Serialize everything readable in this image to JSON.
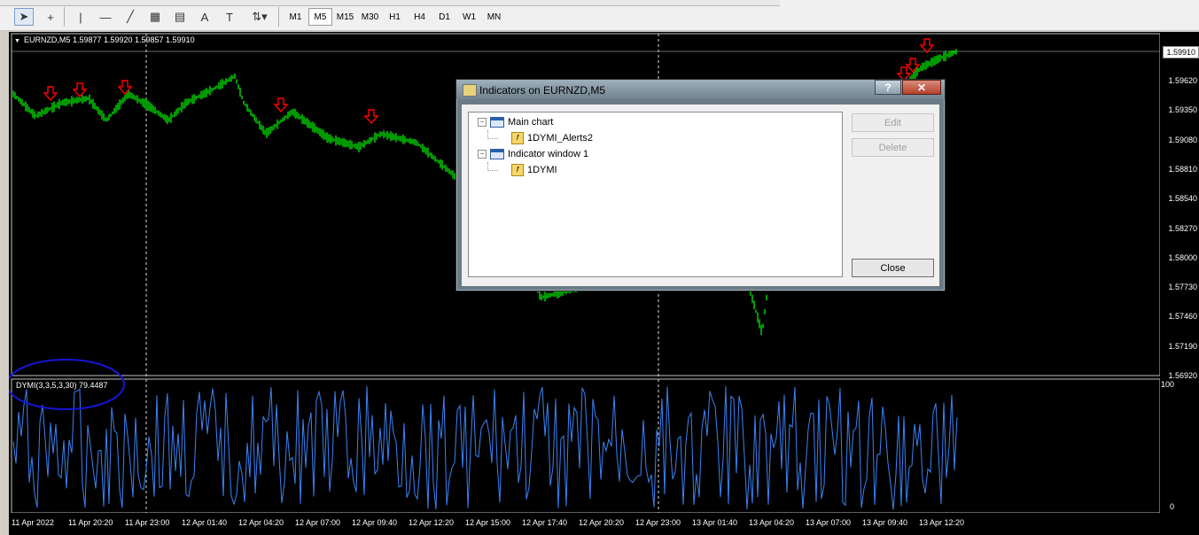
{
  "toolbar": {
    "timeframes": [
      "M1",
      "M5",
      "M15",
      "M30",
      "H1",
      "H4",
      "D1",
      "W1",
      "MN"
    ],
    "active_timeframe": "M5"
  },
  "chart": {
    "header": "EURNZD,M5  1.59877 1.59920 1.59857 1.59910",
    "current_price": "1.59910",
    "price_labels": [
      "1.59620",
      "1.59350",
      "1.59080",
      "1.58810",
      "1.58540",
      "1.58270",
      "1.58000",
      "1.57730",
      "1.57460",
      "1.57190",
      "1.56920"
    ],
    "indicator_label": "DYMI(3,3,5,3,30) 79.4487",
    "indicator_levels": [
      "100",
      "0"
    ],
    "time_labels": [
      "11 Apr 2022",
      "11 Apr 20:20",
      "11 Apr 23:00",
      "12 Apr 01:40",
      "12 Apr 04:20",
      "12 Apr 07:00",
      "12 Apr 09:40",
      "12 Apr 12:20",
      "12 Apr 15:00",
      "12 Apr 17:40",
      "12 Apr 20:20",
      "12 Apr 23:00",
      "13 Apr 01:40",
      "13 Apr 04:20",
      "13 Apr 07:00",
      "13 Apr 09:40",
      "13 Apr 12:20"
    ],
    "colors": {
      "candles": "#00ff00",
      "indicator": "#3b82f6",
      "arrows": "#ff0000",
      "annotation": "#1515d6"
    }
  },
  "dialog": {
    "title": "Indicators on EURNZD,M5",
    "help": "?",
    "close": "✕",
    "tree": [
      {
        "label": "Main chart",
        "children": [
          "1DYMI_Alerts2"
        ]
      },
      {
        "label": "Indicator window 1",
        "children": [
          "1DYMI"
        ]
      }
    ],
    "buttons": {
      "edit": "Edit",
      "delete": "Delete",
      "close": "Close"
    }
  }
}
